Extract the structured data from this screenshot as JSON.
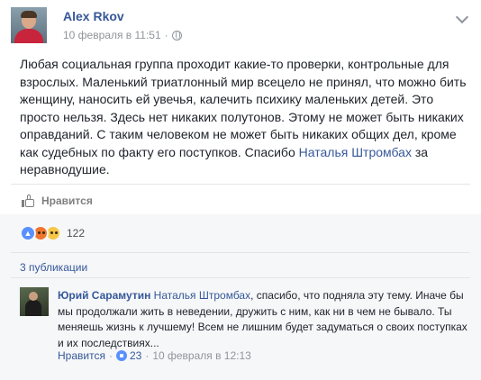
{
  "post": {
    "author": "Alex Rkov",
    "date": "10 февраля в 11:51",
    "separator": "·",
    "text_before_mention": "Любая социальная группа проходит какие-то проверки, контрольные для взрослых. Маленький триатлонный мир всецело не принял, что можно бить женщину, наносить ей увечья, калечить психику маленьких детей. Это просто нельзя. Здесь нет никаких полутонов. Этому не может быть никаких оправданий. С таким человеком не может быть никаких общих дел, кроме как судебных по факту его поступков. Спасибо",
    "mention": "Наталья Штромбах",
    "text_after_mention": "за неравнодушие."
  },
  "actions": {
    "like_label": "Нравится"
  },
  "reactions": {
    "count": "122",
    "types": [
      "like",
      "angry",
      "wow"
    ]
  },
  "shares": {
    "label": "3 публикации"
  },
  "comment": {
    "author": "Юрий Сарамутин",
    "mention": "Наталья Штромбах",
    "text": ", спасибо, что подняла эту тему. Иначе бы мы продолжали жить в неведении, дружить с ним, как ни в чем не бывало. Ты меняешь жизнь к лучшему! Всем не лишним будет задуматься о своих поступках и их последствиях...",
    "like_label": "Нравится",
    "separator": "·",
    "likes_count": "23",
    "date": "10 февраля в 12:13"
  },
  "colors": {
    "link": "#365899",
    "muted": "#90949c",
    "like_blue": "#5890ff"
  }
}
